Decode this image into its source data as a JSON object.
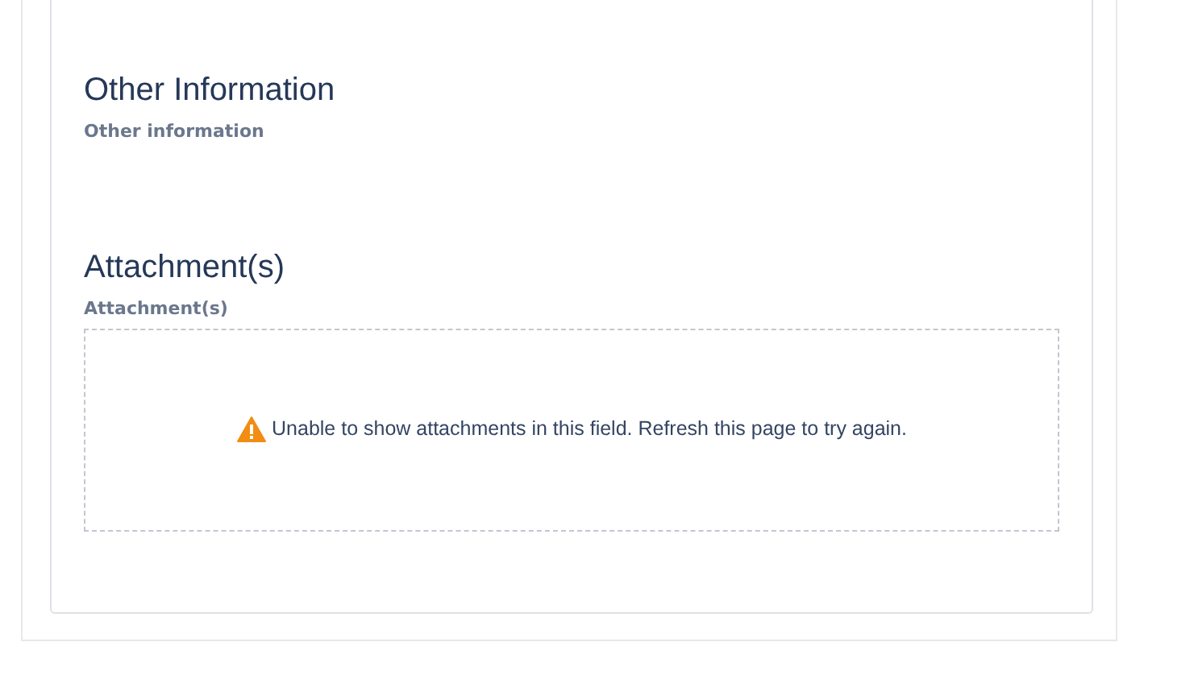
{
  "sections": [
    {
      "title": "Other Information",
      "fields": [
        {
          "label": "Other information"
        }
      ]
    },
    {
      "title": "Attachment(s)",
      "fields": [
        {
          "label": "Attachment(s)",
          "kind": "attachments",
          "message": "Unable to show attachments in this field. Refresh this page to try again."
        }
      ]
    }
  ]
}
